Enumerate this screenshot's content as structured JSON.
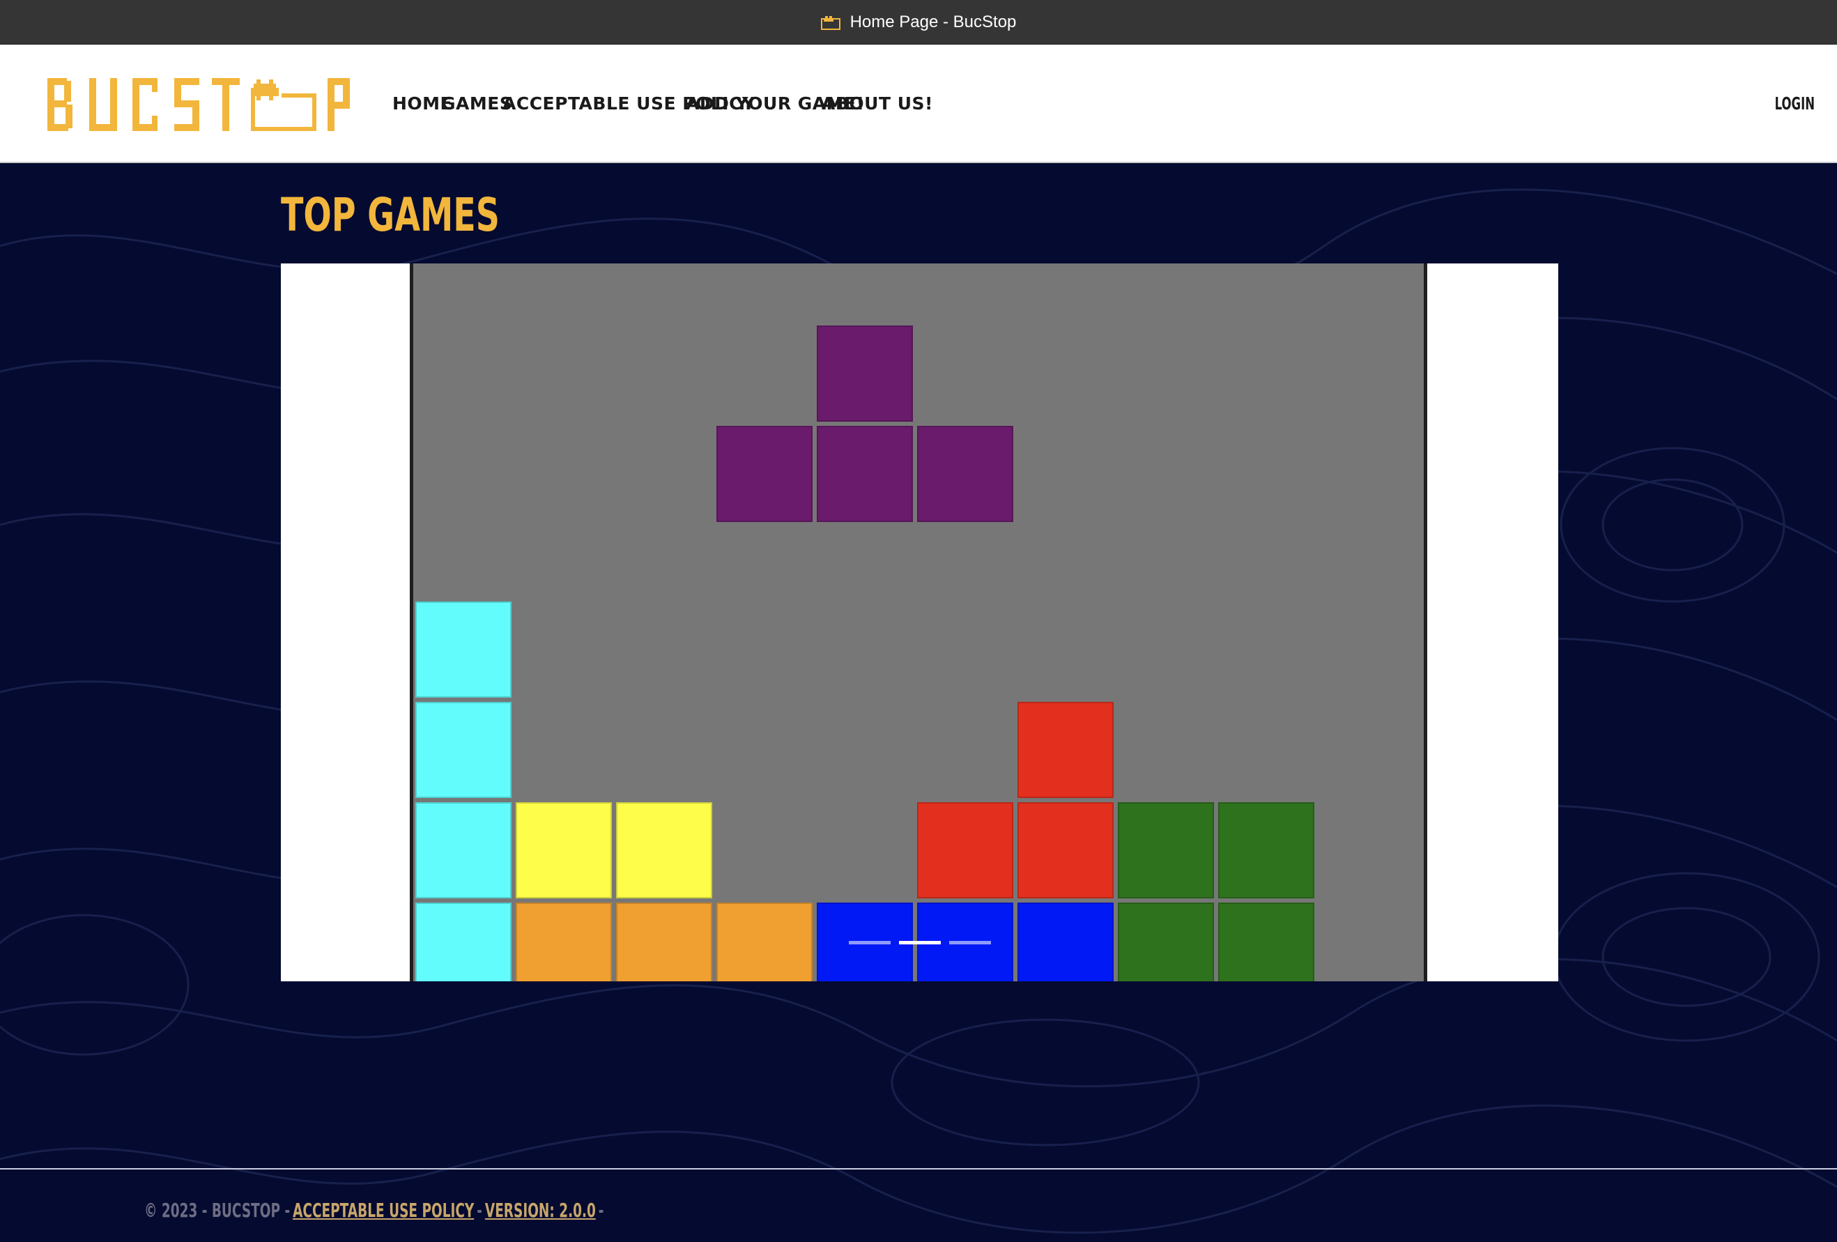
{
  "window": {
    "title": "Home Page - BucStop"
  },
  "brand": {
    "logo_text": "BUCSTOP",
    "accent_color": "#f2b63c"
  },
  "nav": {
    "items": [
      {
        "label": "HOME"
      },
      {
        "label": "GAMES"
      },
      {
        "label": "ACCEPTABLE USE POLICY"
      },
      {
        "label": "ADD YOUR GAME!"
      },
      {
        "label": "ABOUT US!"
      }
    ],
    "login_label": "LOGIN"
  },
  "main": {
    "section_title": "TOP GAMES",
    "carousel": {
      "slide_count": 3,
      "active_slide": 2
    }
  },
  "footer": {
    "copyright": "© 2023 - BUCSTOP -",
    "policy_link": "ACCEPTABLE USE POLICY",
    "sep": "-",
    "version_link": "VERSION: 2.0.0",
    "trail": "-"
  },
  "colors": {
    "background": "#050a30",
    "board": "#777777",
    "purple": "#6a1b6b",
    "cyan": "#63fcfc",
    "yellow": "#fefd4a",
    "orange": "#f0a030",
    "blue": "#0019f5",
    "red": "#e3301e",
    "green": "#2f721e"
  }
}
